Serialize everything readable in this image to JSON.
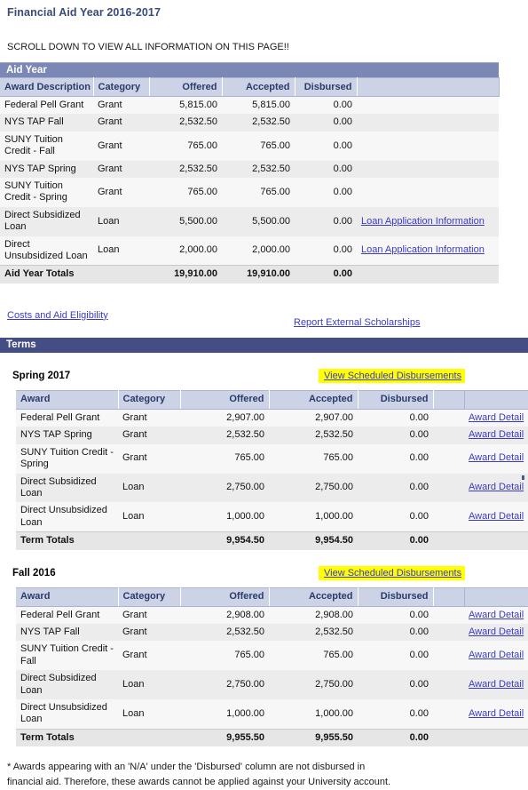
{
  "page": {
    "title": "Financial Aid Year 2016-2017",
    "scroll_notice": "SCROLL DOWN TO VIEW ALL INFORMATION ON THIS PAGE!!",
    "footnote_line1": "* Awards appearing with an 'N/A' under the 'Disbursed' column are not disbursed in",
    "footnote_line2": "financial aid. Therefore, these awards cannot be applied against your University account."
  },
  "colors": {
    "title_blue": "#3b4a7a",
    "aidyear_bar": "#7b87b5",
    "terms_bar": "#454e84",
    "table_header_bg": "#ccd3e6",
    "table_header_text": "#2b3a6b",
    "link": "#3b3bc4",
    "highlight": "#ffff00",
    "row_odd": "#f7f7f7",
    "row_even": "#ececec",
    "totals_row": "#e6e6e6"
  },
  "aid_year": {
    "section_label": "Aid Year",
    "columns": [
      "Award Description",
      "Category",
      "Offered",
      "Accepted",
      "Disbursed",
      ""
    ],
    "rows": [
      {
        "award": "Federal Pell Grant",
        "category": "Grant",
        "offered": "5,815.00",
        "accepted": "5,815.00",
        "disbursed": "0.00",
        "link": ""
      },
      {
        "award": "NYS TAP Fall",
        "category": "Grant",
        "offered": "2,532.50",
        "accepted": "2,532.50",
        "disbursed": "0.00",
        "link": ""
      },
      {
        "award": "SUNY Tuition Credit - Fall",
        "category": "Grant",
        "offered": "765.00",
        "accepted": "765.00",
        "disbursed": "0.00",
        "link": ""
      },
      {
        "award": "NYS TAP Spring",
        "category": "Grant",
        "offered": "2,532.50",
        "accepted": "2,532.50",
        "disbursed": "0.00",
        "link": ""
      },
      {
        "award": "SUNY Tuition Credit - Spring",
        "category": "Grant",
        "offered": "765.00",
        "accepted": "765.00",
        "disbursed": "0.00",
        "link": ""
      },
      {
        "award": "Direct Subsidized Loan",
        "category": "Loan",
        "offered": "5,500.00",
        "accepted": "5,500.00",
        "disbursed": "0.00",
        "link": "Loan Application Information"
      },
      {
        "award": "Direct Unsubsidized Loan",
        "category": "Loan",
        "offered": "2,000.00",
        "accepted": "2,000.00",
        "disbursed": "0.00",
        "link": "Loan Application Information"
      }
    ],
    "totals": {
      "award": "Aid Year Totals",
      "category": "",
      "offered": "19,910.00",
      "accepted": "19,910.00",
      "disbursed": "0.00",
      "link": ""
    }
  },
  "mid_links": {
    "costs_and_aid_eligibility": "Costs and Aid Eligibility",
    "report_external_scholarships": "Report External Scholarships"
  },
  "terms": {
    "section_label": "Terms",
    "blocks": [
      {
        "name": "Spring 2017",
        "disbursements_link": "View Scheduled Disbursements",
        "columns": [
          "Award",
          "Category",
          "Offered",
          "Accepted",
          "Disbursed",
          "",
          ""
        ],
        "rows": [
          {
            "award": "Federal Pell Grant",
            "category": "Grant",
            "offered": "2,907.00",
            "accepted": "2,907.00",
            "disbursed": "0.00",
            "detail": "Award Detail"
          },
          {
            "award": "NYS TAP Spring",
            "category": "Grant",
            "offered": "2,532.50",
            "accepted": "2,532.50",
            "disbursed": "0.00",
            "detail": "Award Detail"
          },
          {
            "award": "SUNY Tuition Credit - Spring",
            "category": "Grant",
            "offered": "765.00",
            "accepted": "765.00",
            "disbursed": "0.00",
            "detail": "Award Detail"
          },
          {
            "award": "Direct Subsidized Loan",
            "category": "Loan",
            "offered": "2,750.00",
            "accepted": "2,750.00",
            "disbursed": "0.00",
            "detail": "Award Detail"
          },
          {
            "award": "Direct Unsubsidized Loan",
            "category": "Loan",
            "offered": "1,000.00",
            "accepted": "1,000.00",
            "disbursed": "0.00",
            "detail": "Award Detail"
          }
        ],
        "totals": {
          "award": "Term Totals",
          "category": "",
          "offered": "9,954.50",
          "accepted": "9,954.50",
          "disbursed": "0.00",
          "detail": ""
        }
      },
      {
        "name": "Fall 2016",
        "disbursements_link": "View Scheduled Disbursements",
        "columns": [
          "Award",
          "Category",
          "Offered",
          "Accepted",
          "Disbursed",
          "",
          ""
        ],
        "rows": [
          {
            "award": "Federal Pell Grant",
            "category": "Grant",
            "offered": "2,908.00",
            "accepted": "2,908.00",
            "disbursed": "0.00",
            "detail": "Award Detail"
          },
          {
            "award": "NYS TAP Fall",
            "category": "Grant",
            "offered": "2,532.50",
            "accepted": "2,532.50",
            "disbursed": "0.00",
            "detail": "Award Detail"
          },
          {
            "award": "SUNY Tuition Credit - Fall",
            "category": "Grant",
            "offered": "765.00",
            "accepted": "765.00",
            "disbursed": "0.00",
            "detail": "Award Detail"
          },
          {
            "award": "Direct Subsidized Loan",
            "category": "Loan",
            "offered": "2,750.00",
            "accepted": "2,750.00",
            "disbursed": "0.00",
            "detail": "Award Detail"
          },
          {
            "award": "Direct Unsubsidized Loan",
            "category": "Loan",
            "offered": "1,000.00",
            "accepted": "1,000.00",
            "disbursed": "0.00",
            "detail": "Award Detail"
          }
        ],
        "totals": {
          "award": "Term Totals",
          "category": "",
          "offered": "9,955.50",
          "accepted": "9,955.50",
          "disbursed": "0.00",
          "detail": ""
        }
      }
    ]
  }
}
